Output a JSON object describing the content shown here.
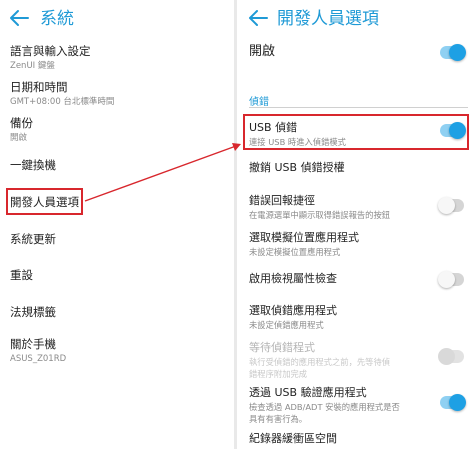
{
  "left": {
    "title": "系統",
    "items": [
      {
        "title": "語言與輸入設定",
        "subtitle": "ZenUI 鍵盤"
      },
      {
        "title": "日期和時間",
        "subtitle": "GMT+08:00 台北標準時間"
      },
      {
        "title": "備份",
        "subtitle": "開啟"
      },
      {
        "title": "一鍵換機",
        "subtitle": ""
      },
      {
        "title": "開發人員選項",
        "subtitle": ""
      },
      {
        "title": "系統更新",
        "subtitle": ""
      },
      {
        "title": "重設",
        "subtitle": ""
      },
      {
        "title": "法規標籤",
        "subtitle": ""
      },
      {
        "title": "關於手機",
        "subtitle": "ASUS_Z01RD"
      }
    ]
  },
  "right": {
    "title": "開發人員選項",
    "master": {
      "title": "開啟",
      "on": true
    },
    "section": "偵錯",
    "items": [
      {
        "title": "USB 偵錯",
        "subtitle": "連接 USB 時進入偵錯模式",
        "toggle": "on"
      },
      {
        "title": "撤銷 USB 偵錯授權",
        "subtitle": "",
        "toggle": "none"
      },
      {
        "title": "錯誤回報捷徑",
        "subtitle": "在電源選單中顯示取得錯誤報告的按鈕",
        "toggle": "off"
      },
      {
        "title": "選取模擬位置應用程式",
        "subtitle": "未設定模擬位置應用程式",
        "toggle": "none"
      },
      {
        "title": "啟用檢視屬性檢查",
        "subtitle": "",
        "toggle": "off"
      },
      {
        "title": "選取偵錯應用程式",
        "subtitle": "未設定偵錯應用程式",
        "toggle": "none"
      },
      {
        "title": "等待偵錯程式",
        "subtitle": "執行受偵錯的應用程式之前，先等待偵錯程序附加完成",
        "toggle": "disabled"
      },
      {
        "title": "透過 USB 驗證應用程式",
        "subtitle": "檢查透過 ADB/ADT 安裝的應用程式是否具有有害行為。",
        "toggle": "on"
      },
      {
        "title": "紀錄器緩衝區空間",
        "subtitle": "",
        "toggle": "none"
      }
    ]
  },
  "colors": {
    "accent": "#1f9ad6",
    "toggle_on": "#1ea0e4",
    "highlight": "#d8272d"
  }
}
